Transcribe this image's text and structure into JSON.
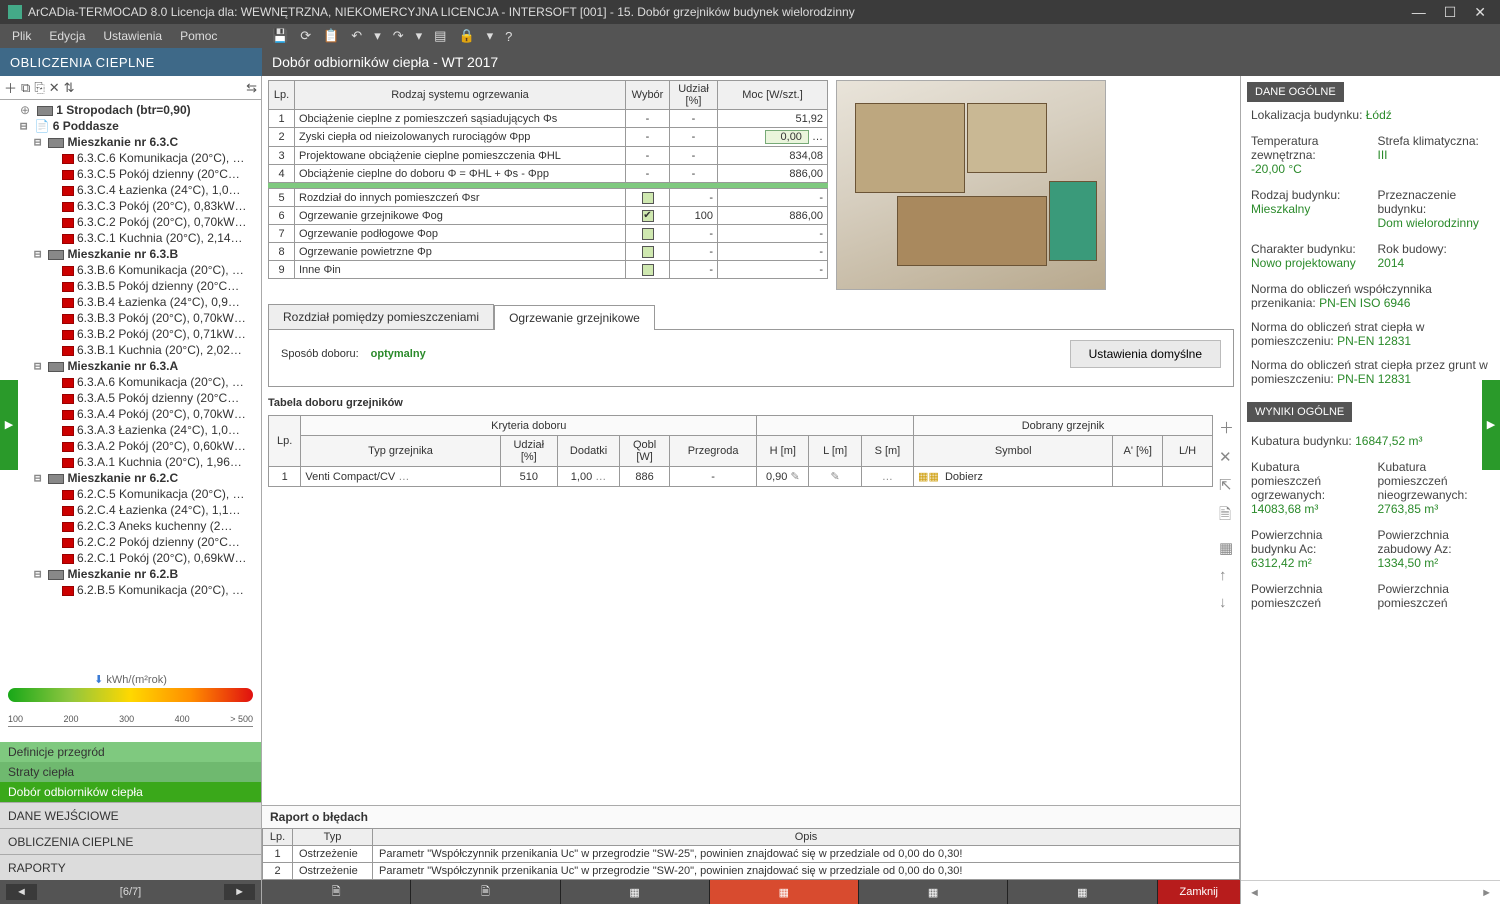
{
  "window": {
    "title": "ArCADia-TERMOCAD 8.0 Licencja dla: WEWNĘTRZNA, NIEKOMERCYJNA LICENCJA - INTERSOFT [001] - 15. Dobór grzejników budynek wielorodzinny"
  },
  "menu": {
    "file": "Plik",
    "edit": "Edycja",
    "settings": "Ustawienia",
    "help": "Pomoc"
  },
  "left_header": "OBLICZENIA CIEPLNE",
  "center_header": "Dobór odbiorników ciepła - WT 2017",
  "tree": {
    "top": "1 Stropodach (btr=0,90)",
    "group": "6 Poddasze",
    "flats": [
      {
        "name": "Mieszkanie nr 6.3.C",
        "rooms": [
          "6.3.C.6 Komunikacja (20°C), …",
          "6.3.C.5 Pokój dzienny (20°C…",
          "6.3.C.4 Łazienka (24°C), 1,0…",
          "6.3.C.3 Pokój (20°C), 0,83kW…",
          "6.3.C.2 Pokój (20°C), 0,70kW…",
          "6.3.C.1 Kuchnia (20°C), 2,14…"
        ]
      },
      {
        "name": "Mieszkanie nr 6.3.B",
        "rooms": [
          "6.3.B.6 Komunikacja (20°C), …",
          "6.3.B.5 Pokój dzienny (20°C…",
          "6.3.B.4 Łazienka (24°C), 0,9…",
          "6.3.B.3 Pokój (20°C), 0,70kW…",
          "6.3.B.2 Pokój (20°C), 0,71kW…",
          "6.3.B.1 Kuchnia (20°C), 2,02…"
        ]
      },
      {
        "name": "Mieszkanie nr 6.3.A",
        "rooms": [
          "6.3.A.6 Komunikacja (20°C), …",
          "6.3.A.5 Pokój dzienny (20°C…",
          "6.3.A.4 Pokój (20°C), 0,70kW…",
          "6.3.A.3 Łazienka (24°C), 1,0…",
          "6.3.A.2 Pokój (20°C), 0,60kW…",
          "6.3.A.1 Kuchnia (20°C), 1,96…"
        ]
      },
      {
        "name": "Mieszkanie nr 6.2.C",
        "rooms": [
          "6.2.C.5 Komunikacja (20°C), …",
          "6.2.C.4 Łazienka (24°C), 1,1…",
          "6.2.C.3 Aneks kuchenny (2…",
          "6.2.C.2 Pokój dzienny (20°C…",
          "6.2.C.1 Pokój (20°C), 0,69kW…"
        ]
      },
      {
        "name": "Mieszkanie nr 6.2.B",
        "rooms": [
          "6.2.B.5 Komunikacja (20°C), …"
        ]
      }
    ]
  },
  "scale": {
    "unit": "kWh/(m²rok)",
    "ticks": [
      "100",
      "200",
      "300",
      "400",
      "> 500"
    ]
  },
  "cats": {
    "c1": "Definicje przegród",
    "c2": "Straty ciepła",
    "c3": "Dobór odbiorników ciepła",
    "g1": "DANE WEJŚCIOWE",
    "g2": "OBLICZENIA CIEPLNE",
    "g3": "RAPORTY"
  },
  "left_footer": {
    "page": "[6/7]"
  },
  "table1": {
    "h_lp": "Lp.",
    "h_type": "Rodzaj systemu ogrzewania",
    "h_sel": "Wybór",
    "h_share": "Udział [%]",
    "h_power": "Moc [W/szt.]",
    "rows_a": [
      {
        "lp": "1",
        "name": "Obciążenie cieplne z pomieszczeń sąsiadujących Φs",
        "sel": "-",
        "share": "-",
        "power": "51,92"
      },
      {
        "lp": "2",
        "name": "Zyski ciepła od nieizolowanych rurociągów Φpp",
        "sel": "-",
        "share": "-",
        "power_in": "0,00"
      },
      {
        "lp": "3",
        "name": "Projektowane obciążenie cieplne pomieszczenia ΦHL",
        "sel": "-",
        "share": "-",
        "power": "834,08"
      },
      {
        "lp": "4",
        "name": "Obciążenie cieplne do doboru Φ = ΦHL + Φs - Φpp",
        "sel": "-",
        "share": "-",
        "power": "886,00"
      }
    ],
    "rows_b": [
      {
        "lp": "5",
        "name": "Rozdział do innych pomieszczeń Φsr",
        "chk": false,
        "share": "-",
        "power": "-"
      },
      {
        "lp": "6",
        "name": "Ogrzewanie grzejnikowe Φog",
        "chk": true,
        "share": "100",
        "power": "886,00"
      },
      {
        "lp": "7",
        "name": "Ogrzewanie podłogowe Φop",
        "chk": false,
        "share": "-",
        "power": "-"
      },
      {
        "lp": "8",
        "name": "Ogrzewanie powietrzne Φp",
        "chk": false,
        "share": "-",
        "power": "-"
      },
      {
        "lp": "9",
        "name": "Inne Φin",
        "chk": false,
        "share": "-",
        "power": "-"
      }
    ]
  },
  "tabs": {
    "t1": "Rozdział pomiędzy pomieszczeniami",
    "t2": "Ogrzewanie grzejnikowe"
  },
  "panel": {
    "mode_lbl": "Sposób doboru:",
    "mode_val": "optymalny",
    "defaults_btn": "Ustawienia domyślne",
    "table_title": "Tabela doboru grzejników",
    "group1": "Kryteria doboru",
    "group2": "Dobrany grzejnik",
    "h": {
      "lp": "Lp.",
      "type": "Typ grzejnika",
      "share": "Udział [%]",
      "add": "Dodatki",
      "qobl": "Qobl [W]",
      "wall": "Przegroda",
      "H": "H [m]",
      "L": "L [m]",
      "S": "S [m]",
      "sym": "Symbol",
      "A": "A' [%]",
      "LH": "L/H"
    },
    "row": {
      "lp": "1",
      "type": "Venti Compact/CV",
      "share": "510",
      "add": "1,00",
      "qobl": "886",
      "wall": "-",
      "H": "0,90",
      "L": "",
      "S": "",
      "sym": "Dobierz",
      "A": "",
      "LH": ""
    }
  },
  "errors": {
    "title": "Raport o błędach",
    "h_lp": "Lp.",
    "h_type": "Typ",
    "h_desc": "Opis",
    "rows": [
      {
        "lp": "1",
        "type": "Ostrzeżenie",
        "desc": "Parametr \"Współczynnik przenikania Uc\" w przegrodzie \"SW-25\", powinien znajdować się w przedziale od 0,00 do 0,30!"
      },
      {
        "lp": "2",
        "type": "Ostrzeżenie",
        "desc": "Parametr \"Współczynnik przenikania Uc\" w przegrodzie \"SW-20\", powinien znajdować się w przedziale od 0,00 do 0,30!"
      }
    ]
  },
  "right": {
    "h1": "DANE OGÓLNE",
    "loc_lbl": "Lokalizacja budynku:",
    "loc_val": "Łódź",
    "temp_lbl": "Temperatura zewnętrzna:",
    "temp_val": "-20,00 °C",
    "zone_lbl": "Strefa klimatyczna:",
    "zone_val": "III",
    "btype_lbl": "Rodzaj budynku:",
    "btype_val": "Mieszkalny",
    "dest_lbl": "Przeznaczenie budynku:",
    "dest_val": "Dom wielorodzinny",
    "char_lbl": "Charakter budynku:",
    "char_val": "Nowo projektowany",
    "year_lbl": "Rok budowy:",
    "year_val": "2014",
    "n1_lbl": "Norma do obliczeń współczynnika przenikania:",
    "n1_val": "PN-EN ISO 6946",
    "n2_lbl": "Norma do obliczeń strat ciepła w pomieszczeniu:",
    "n2_val": "PN-EN 12831",
    "n3_lbl": "Norma do obliczeń strat ciepła przez grunt w pomieszczeniu:",
    "n3_val": "PN-EN 12831",
    "h2": "WYNIKI OGÓLNE",
    "kub_lbl": "Kubatura budynku:",
    "kub_val": "16847,52 m³",
    "kh_lbl": "Kubatura pomieszczeń ogrzewanych:",
    "kh_val": "14083,68 m³",
    "kn_lbl": "Kubatura pomieszczeń nieogrzewanych:",
    "kn_val": "2763,85 m³",
    "pa_lbl": "Powierzchnia budynku Ac:",
    "pa_val": "6312,42 m²",
    "pz_lbl": "Powierzchnia zabudowy Az:",
    "pz_val": "1334,50 m²",
    "pp1_lbl": "Powierzchnia pomieszczeń",
    "pp2_lbl": "Powierzchnia pomieszczeń"
  },
  "close_btn": "Zamknij"
}
